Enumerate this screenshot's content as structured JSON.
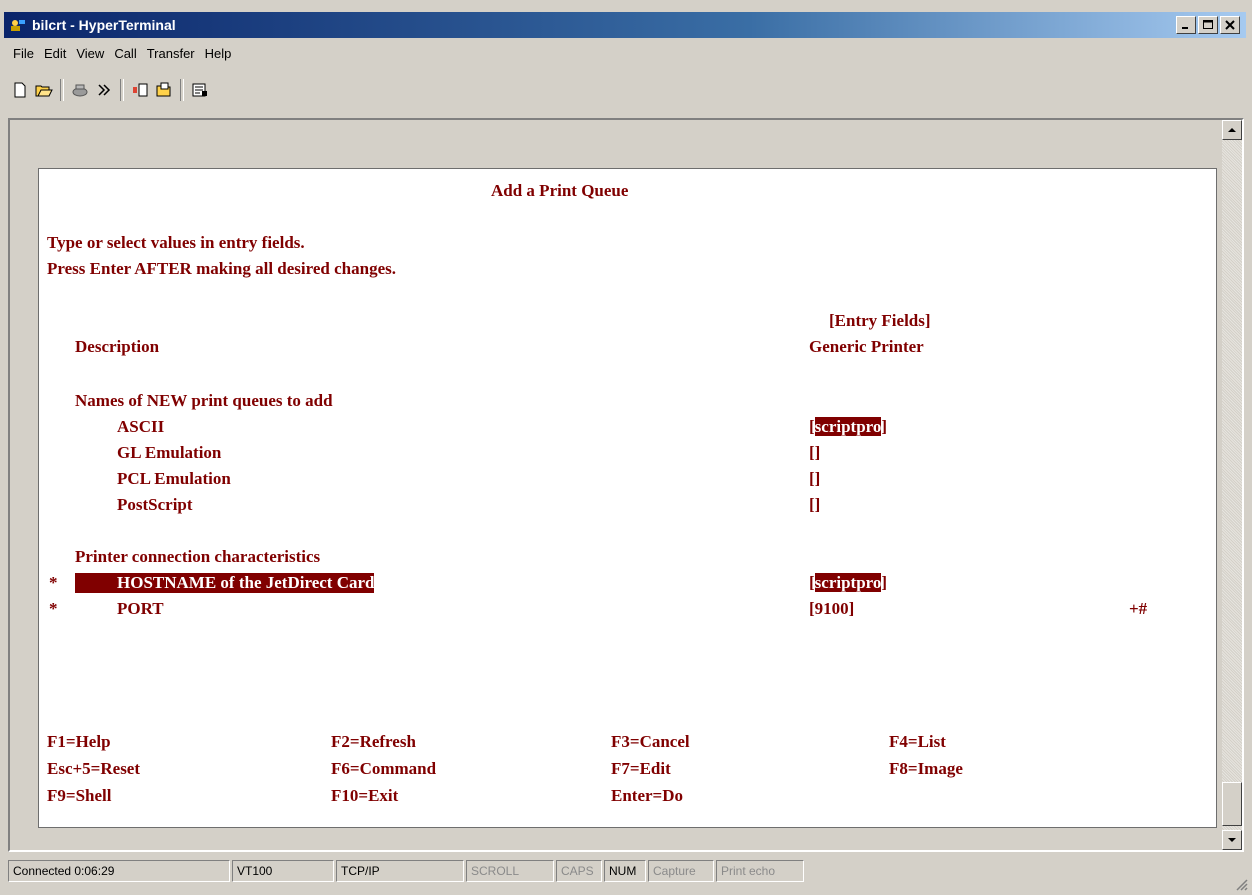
{
  "window": {
    "title": "bilcrt - HyperTerminal"
  },
  "menubar": [
    "File",
    "Edit",
    "View",
    "Call",
    "Transfer",
    "Help"
  ],
  "toolbar": [
    "new-icon",
    "open-icon",
    "disconnect-icon",
    "connect-icon",
    "send-icon",
    "receive-icon",
    "properties-icon"
  ],
  "terminal": {
    "title": "Add a Print Queue",
    "instructions": [
      "Type or select values in entry fields.",
      "Press Enter AFTER making all desired changes."
    ],
    "entry_fields_header": "[Entry Fields]",
    "description_label": "Description",
    "description_value": "Generic Printer",
    "names_section": "Names of NEW print queues to add",
    "fields": {
      "ascii_label": "ASCII",
      "ascii_value": "scriptpro",
      "gl_label": "GL Emulation",
      "gl_value": "",
      "pcl_label": "PCL Emulation",
      "pcl_value": "",
      "ps_label": "PostScript",
      "ps_value": "",
      "hostname_label": "HOSTNAME of the JetDirect Card",
      "hostname_value": "scriptpro",
      "port_label": "PORT",
      "port_value": "9100",
      "port_flag": "+#"
    },
    "connection_section": "Printer connection characteristics",
    "required_marker": "*",
    "function_keys": [
      "F1=Help",
      "F2=Refresh",
      "F3=Cancel",
      "F4=List",
      "Esc+5=Reset",
      "F6=Command",
      "F7=Edit",
      "F8=Image",
      "F9=Shell",
      "F10=Exit",
      "Enter=Do"
    ]
  },
  "status": {
    "connected": "Connected 0:06:29",
    "emulation": "VT100",
    "protocol": "TCP/IP",
    "scroll": "SCROLL",
    "caps": "CAPS",
    "num": "NUM",
    "capture": "Capture",
    "print_echo": "Print echo"
  }
}
